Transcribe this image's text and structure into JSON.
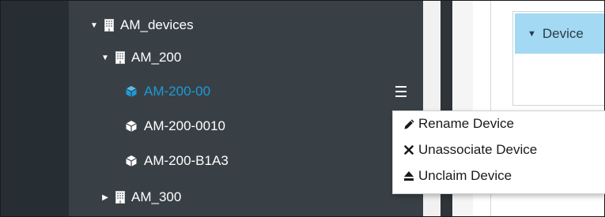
{
  "tree": {
    "items": [
      {
        "label": "AM_devices",
        "expanded": true,
        "icon": "building-icon",
        "level": 0
      },
      {
        "label": "AM_200",
        "expanded": true,
        "icon": "building-icon",
        "level": 1
      },
      {
        "label": "AM-200-00",
        "selected": true,
        "icon": "cube-icon",
        "level": 2
      },
      {
        "label": "AM-200-0010",
        "icon": "cube-icon",
        "level": 2
      },
      {
        "label": "AM-200-B1A3",
        "icon": "cube-icon",
        "level": 2
      },
      {
        "label": "AM_300",
        "expanded": false,
        "icon": "building-icon",
        "level": 1
      }
    ]
  },
  "context_menu": {
    "items": [
      {
        "label": "Rename Device",
        "icon": "pencil-icon"
      },
      {
        "label": "Unassociate Device",
        "icon": "x-icon"
      },
      {
        "label": "Unclaim Device",
        "icon": "eject-icon"
      }
    ]
  },
  "device_panel": {
    "header_label": "Device"
  },
  "colors": {
    "tree_background": "#394045",
    "rail_background": "#272e33",
    "selected_text": "#1c9ad8",
    "device_header_bg": "#a3d9f2"
  }
}
